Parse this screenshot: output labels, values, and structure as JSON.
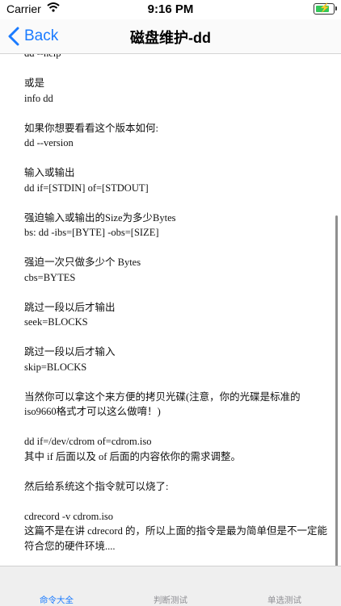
{
  "status": {
    "carrier": "Carrier",
    "time": "9:16 PM"
  },
  "nav": {
    "back_label": "Back",
    "title": "磁盘维护-dd"
  },
  "content": {
    "lines": [
      "dd --help",
      "",
      "或是",
      "info dd",
      "",
      "如果你想要看看这个版本如何:",
      "dd --version",
      "",
      "输入或输出",
      "dd if=[STDIN] of=[STDOUT]",
      "",
      "强迫输入或输出的Size为多少Bytes",
      "bs: dd -ibs=[BYTE] -obs=[SIZE]",
      "",
      "强迫一次只做多少个 Bytes",
      "cbs=BYTES",
      "",
      "跳过一段以后才输出",
      "seek=BLOCKS",
      "",
      "跳过一段以后才输入",
      "skip=BLOCKS",
      "",
      "    当然你可以拿这个来方便的拷贝光碟(注意，你的光碟是标准的",
      "iso9660格式才可以这么做唷！)",
      "",
      "dd if=/dev/cdrom of=cdrom.iso",
      "其中 if 后面以及 of 后面的内容依你的需求调整。",
      "",
      "然后给系统这个指令就可以烧了:",
      "",
      "cdrecord -v cdrom.iso",
      "这篇不是在讲 cdrecord 的，所以上面的指令是最为简单但是不一定能",
      "符合您的硬件环境...."
    ]
  },
  "tabs": [
    {
      "label": "命令大全"
    },
    {
      "label": "判断测试"
    },
    {
      "label": "单选测试"
    }
  ],
  "colors": {
    "accent": "#1a7bff",
    "battery": "#34c759",
    "inactive": "#8e8e93"
  },
  "icons": {
    "back": "chevron-left-icon",
    "wifi": "wifi-icon",
    "battery": "battery-charging-icon"
  }
}
